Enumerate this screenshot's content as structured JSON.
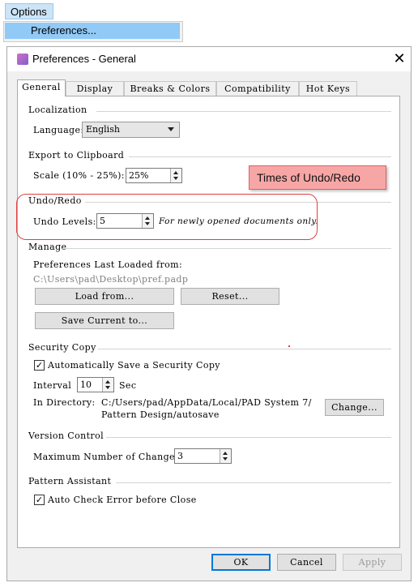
{
  "menu": {
    "options_label": "Options",
    "preferences_label": "Preferences..."
  },
  "dialog": {
    "title": "Preferences - General",
    "close_glyph": "✕",
    "tabs": [
      {
        "label": "General",
        "active": true
      },
      {
        "label": "Display"
      },
      {
        "label": "Breaks & Colors"
      },
      {
        "label": "Compatibility"
      },
      {
        "label": "Hot Keys"
      }
    ]
  },
  "localization": {
    "header": "Localization",
    "language_label": "Language:",
    "language_value": "English"
  },
  "clipboard": {
    "header": "Export to Clipboard",
    "scale_label": "Scale (10% - 25%):",
    "scale_value": "25%"
  },
  "undo": {
    "header": "Undo/Redo",
    "levels_label": "Undo Levels:",
    "levels_value": "5",
    "note": "For newly opened documents only."
  },
  "manage": {
    "header": "Manage",
    "loaded_label": "Preferences Last Loaded from:",
    "loaded_path": "C:\\Users\\pad\\Desktop\\pref.padp",
    "load_button": "Load from...",
    "reset_button": "Reset...",
    "save_button": "Save Current to..."
  },
  "security": {
    "header": "Security Copy",
    "autosave_label": "Automatically Save a Security Copy",
    "autosave_checked": true,
    "check_glyph": "✓",
    "interval_label": "Interval",
    "interval_value": "10",
    "interval_unit": "Sec",
    "directory_label": "In Directory:",
    "directory_line1": "C:/Users/pad/AppData/Local/PAD System 7/",
    "directory_line2": "Pattern Design/autosave",
    "change_button": "Change..."
  },
  "version": {
    "header": "Version Control",
    "max_label": "Maximum Number of Changesets",
    "max_value": "3"
  },
  "assistant": {
    "header": "Pattern Assistant",
    "autocheck_label": "Auto Check Error before Close",
    "autocheck_checked": true,
    "check_glyph": "✓"
  },
  "footer": {
    "ok": "OK",
    "cancel": "Cancel",
    "apply": "Apply"
  },
  "annotation": {
    "callout_text": "Times of Undo/Redo"
  },
  "colors": {
    "accent": "#0078d7",
    "menu_highlight": "#91c9f7",
    "callout_fill": "#f7a6a6",
    "annotation_red": "#e04040"
  }
}
